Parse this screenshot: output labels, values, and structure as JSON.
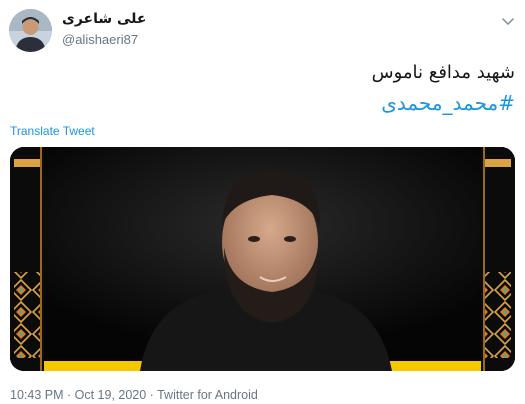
{
  "author": {
    "display_name": "علی شاعری",
    "handle": "@alishaeri87"
  },
  "tweet": {
    "text_line": "شهید مدافع ناموس",
    "hashtag": "#محمد_محمدی",
    "translate_label": "Translate Tweet"
  },
  "footer": {
    "time": "10:43 PM",
    "separator1": " · ",
    "date": "Oct 19, 2020",
    "separator2": " · ",
    "source": "Twitter for Android"
  },
  "icons": {
    "caret": "chevron-down-icon",
    "avatar": "avatar"
  },
  "colors": {
    "link": "#1b95e0",
    "text": "#14171a",
    "muted": "#657786",
    "accent_gold": "#f5c800",
    "media_bg": "#0b0b0b"
  }
}
